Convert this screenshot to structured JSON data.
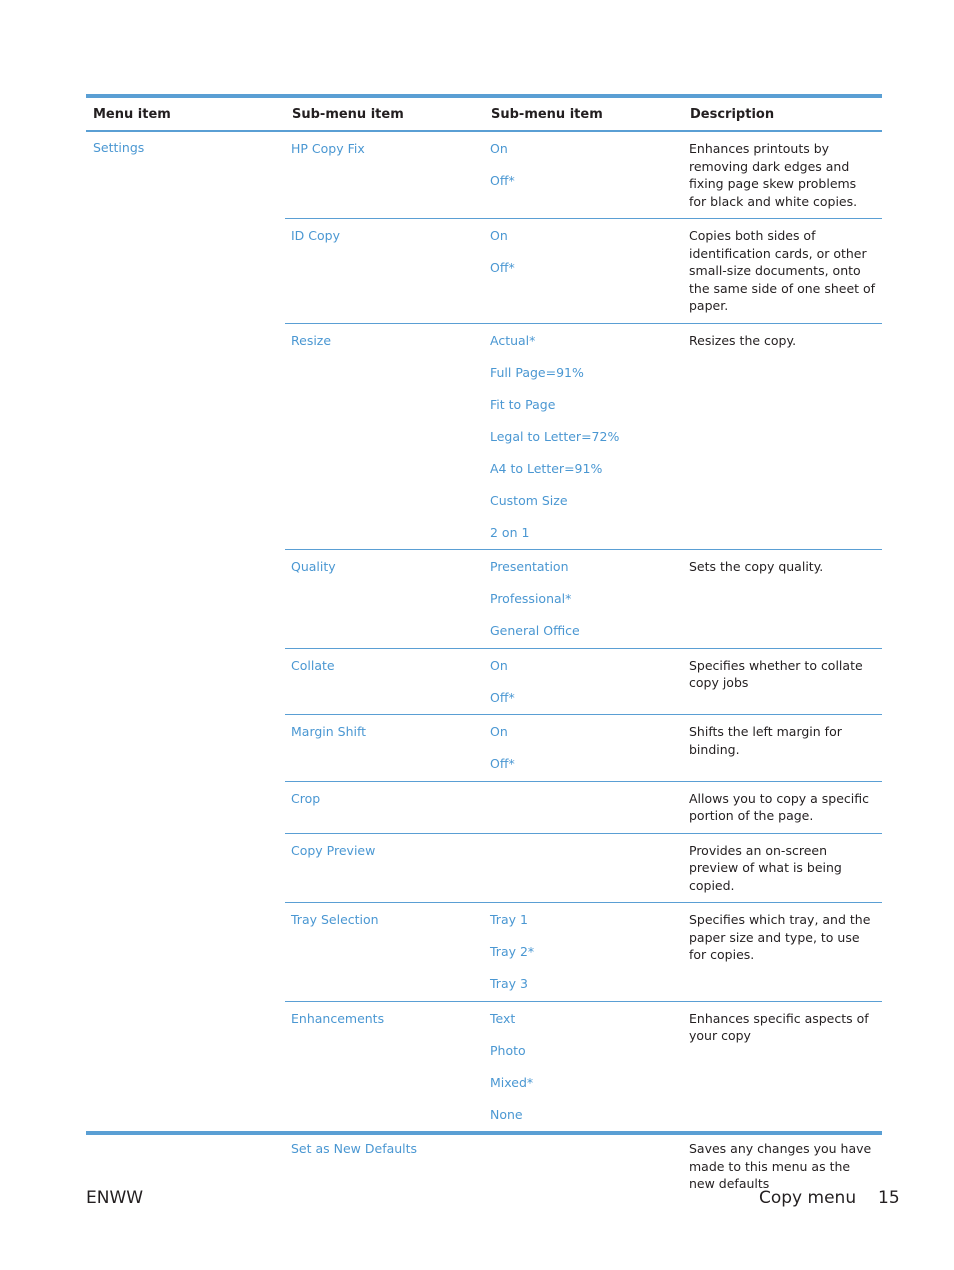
{
  "table": {
    "headers": [
      "Menu item",
      "Sub-menu item",
      "Sub-menu item",
      "Description"
    ],
    "menu_item": "Settings",
    "rows": [
      {
        "submenu": "HP Copy Fix",
        "options": [
          "On",
          "Off*"
        ],
        "description": "Enhances printouts by removing dark edges and fixing page skew problems for black and white copies."
      },
      {
        "submenu": "ID Copy",
        "options": [
          "On",
          "Off*"
        ],
        "description": "Copies both sides of identification cards, or other small-size documents, onto the same side of one sheet of paper."
      },
      {
        "submenu": "Resize",
        "options": [
          "Actual*",
          "Full Page=91%",
          "Fit to Page",
          "Legal to Letter=72%",
          "A4 to Letter=91%",
          "Custom Size",
          "2 on 1"
        ],
        "description": "Resizes the copy."
      },
      {
        "submenu": "Quality",
        "options": [
          "Presentation",
          "Professional*",
          "General Office"
        ],
        "description": "Sets the copy quality."
      },
      {
        "submenu": "Collate",
        "options": [
          "On",
          "Off*"
        ],
        "description": "Specifies whether to collate copy jobs"
      },
      {
        "submenu": "Margin Shift",
        "options": [
          "On",
          "Off*"
        ],
        "description": "Shifts the left margin for binding."
      },
      {
        "submenu": "Crop",
        "options": [],
        "description": "Allows you to copy a specific portion of the page."
      },
      {
        "submenu": "Copy Preview",
        "options": [],
        "description": "Provides an on-screen preview of what is being copied."
      },
      {
        "submenu": "Tray Selection",
        "options": [
          "Tray 1",
          "Tray 2*",
          "Tray 3"
        ],
        "description": "Specifies which tray, and the paper size and type, to use for copies."
      },
      {
        "submenu": "Enhancements",
        "options": [
          "Text",
          "Photo",
          "Mixed*",
          "None"
        ],
        "description": "Enhances specific aspects of your copy"
      },
      {
        "submenu": "Set as New Defaults",
        "options": [],
        "description": "Saves any changes you have made to this menu as the new defaults"
      }
    ]
  },
  "footer": {
    "left": "ENWW",
    "section": "Copy menu",
    "page": "15"
  },
  "colors": {
    "accent": "#5a9fd4",
    "link": "#4a97d2"
  }
}
